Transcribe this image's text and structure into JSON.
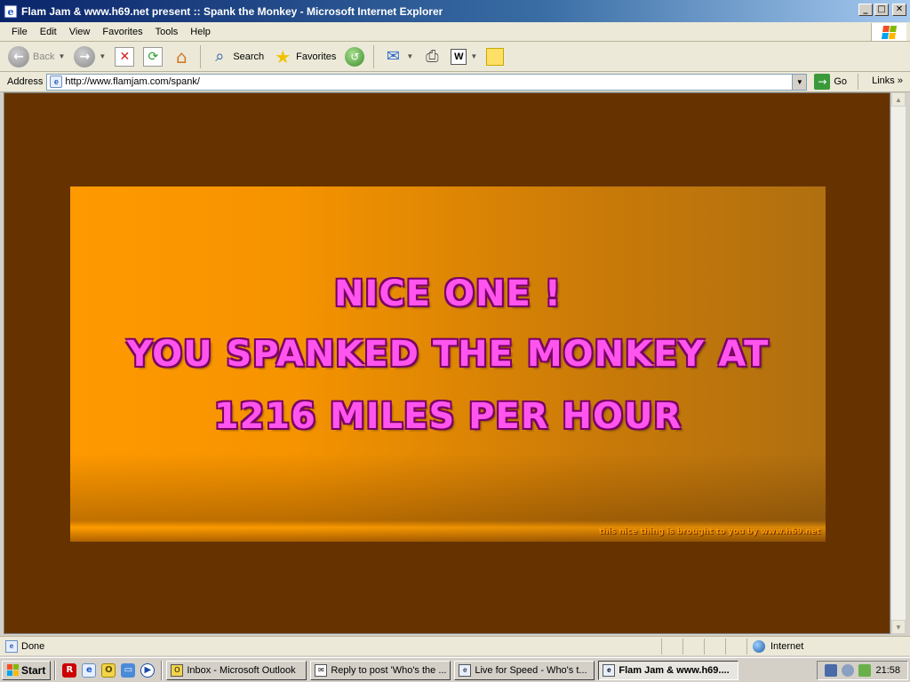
{
  "window": {
    "title": "Flam Jam & www.h69.net present :: Spank the Monkey - Microsoft Internet Explorer",
    "minimize": "_",
    "maximize": "□",
    "close": "✕"
  },
  "menu": {
    "items": [
      "File",
      "Edit",
      "View",
      "Favorites",
      "Tools",
      "Help"
    ]
  },
  "toolbar": {
    "back_label": "Back",
    "search_label": "Search",
    "favorites_label": "Favorites"
  },
  "address": {
    "label": "Address",
    "url": "http://www.flamjam.com/spank/",
    "go_label": "Go",
    "links_label": "Links"
  },
  "page": {
    "line1": "NICE ONE !",
    "line2": "YOU SPANKED THE MONKEY AT",
    "line3": "1216 MILES PER HOUR",
    "credit": "this nice thing is brought to you by www.h69.net",
    "colors": {
      "background": "#663300",
      "banner": "#ff9900",
      "text": "#ff55ee"
    }
  },
  "status": {
    "text": "Done",
    "zone": "Internet"
  },
  "taskbar": {
    "start_label": "Start",
    "tasks": [
      "Inbox - Microsoft Outlook",
      "Reply to post 'Who's the ...",
      "Live for Speed - Who's t...",
      "Flam Jam & www.h69...."
    ],
    "clock": "21:58"
  }
}
